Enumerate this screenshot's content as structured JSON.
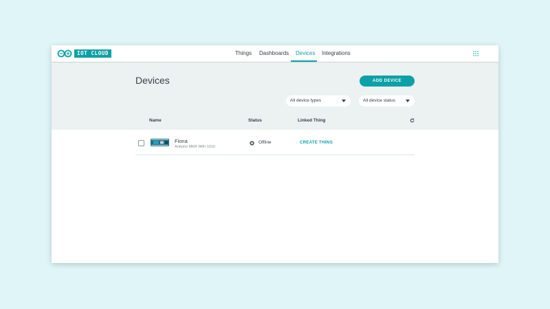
{
  "brand": {
    "logo_text": "IOT CLOUD",
    "accent_color": "#0ca1a6"
  },
  "nav": {
    "items": [
      {
        "label": "Things",
        "active": false
      },
      {
        "label": "Dashboards",
        "active": false
      },
      {
        "label": "Devices",
        "active": true
      },
      {
        "label": "Integrations",
        "active": false
      }
    ],
    "apps_icon": "grid-apps-icon"
  },
  "page": {
    "title": "Devices",
    "add_button_label": "ADD DEVICE"
  },
  "filters": {
    "device_type": "All device types",
    "device_status": "All device status"
  },
  "table": {
    "columns": [
      "Name",
      "Status",
      "Linked Thing"
    ],
    "refresh_icon": "refresh-icon",
    "rows": [
      {
        "name": "Fiona",
        "type": "Arduino MKR WiFi 1010",
        "status": "Offline",
        "linked_action": "CREATE THING"
      }
    ]
  }
}
